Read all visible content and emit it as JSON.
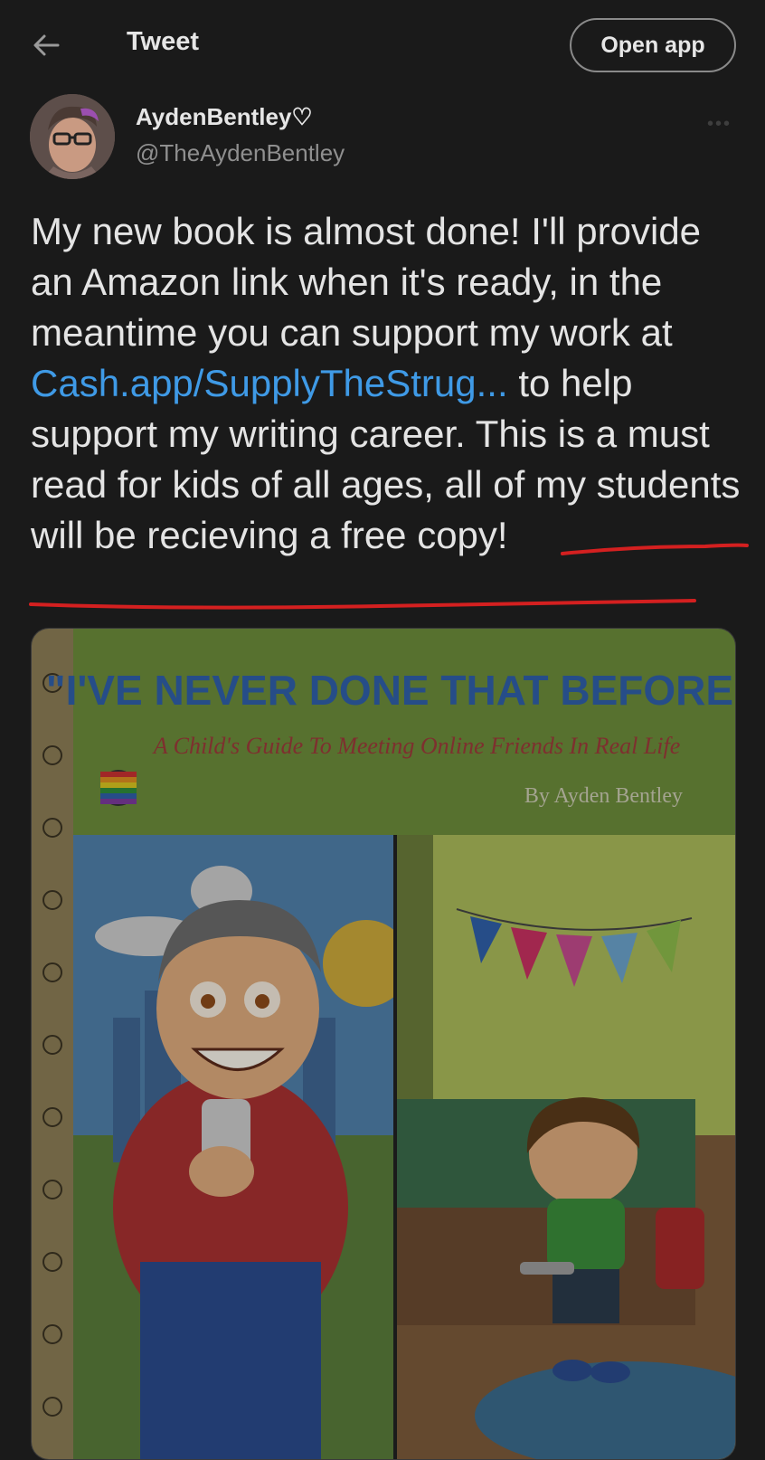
{
  "header": {
    "back_icon": "back-arrow-icon",
    "title": "Tweet",
    "open_app_label": "Open app"
  },
  "author": {
    "display_name": "AydenBentley♡",
    "handle": "@TheAydenBentley"
  },
  "tweet": {
    "text_before_link": "My new book is almost done! I'll provide an Amazon link when it's ready, in the meantime you can support my work at ",
    "link_text": "Cash.app/SupplyTheStrug...",
    "text_after_link": " to help support my writing career. This is a must read for kids of all ages, ",
    "underlined_text": "all of my students will be recieving a free copy",
    "text_end": "!",
    "link_color": "#3f9ae6",
    "underline_color": "#d42020"
  },
  "media": {
    "title": "\"I'VE NEVER DONE THAT BEFORE...\"",
    "subtitle": "A Child's Guide To Meeting Online Friends In Real Life",
    "author_line": "By Ayden Bentley",
    "banner_color": "#6b8a3a",
    "title_color": "#2f5fa6",
    "subtitle_color": "#9a3a3a"
  }
}
